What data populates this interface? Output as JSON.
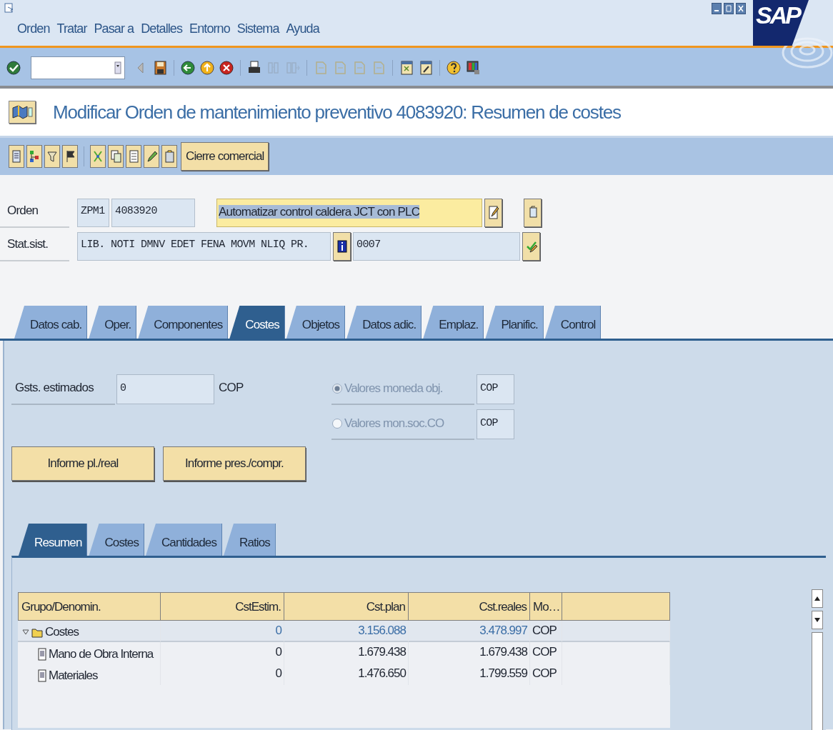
{
  "window": {
    "menu": [
      {
        "label": "Orden"
      },
      {
        "label": "Tratar"
      },
      {
        "label": "Pasar a"
      },
      {
        "label": "Detalles"
      },
      {
        "label": "Entorno"
      },
      {
        "label": "Sistema"
      },
      {
        "label": "Ayuda"
      }
    ],
    "logo": "SAP"
  },
  "title": "Modificar Orden de mantenimiento preventivo 4083920: Resumen de costes",
  "app_toolbar": {
    "button": "Cierre comercial"
  },
  "header": {
    "order": {
      "label": "Orden",
      "type": "ZPM1",
      "number": "4083920",
      "description": "Automatizar control caldera JCT con PLC",
      "selected": true
    },
    "status": {
      "label": "Stat.sist.",
      "system": "LIB. NOTI DMNV EDET FENA MOVM NLIQ PR.",
      "user": "0007"
    }
  },
  "tabs": [
    {
      "label": "Datos cab.",
      "selected": false
    },
    {
      "label": "Oper.",
      "selected": false
    },
    {
      "label": "Componentes",
      "selected": false
    },
    {
      "label": "Costes",
      "selected": true
    },
    {
      "label": "Objetos",
      "selected": false
    },
    {
      "label": "Datos adic.",
      "selected": false
    },
    {
      "label": "Emplaz.",
      "selected": false
    },
    {
      "label": "Planific.",
      "selected": false
    },
    {
      "label": "Control",
      "selected": false
    }
  ],
  "costs": {
    "estimated": {
      "label": "Gsts. estimados",
      "value": "0",
      "currency": "COP"
    },
    "currency_options": [
      {
        "label": "Valores moneda obj.",
        "selected": true,
        "disabled": true,
        "currency": "COP"
      },
      {
        "label": "Valores mon.soc.CO",
        "selected": false,
        "disabled": true,
        "currency": "COP"
      }
    ],
    "buttons": [
      "Informe pl./real",
      "Informe pres./compr."
    ]
  },
  "subtabs": [
    {
      "label": "Resumen",
      "selected": true
    },
    {
      "label": "Costes",
      "selected": false
    },
    {
      "label": "Cantidades",
      "selected": false
    },
    {
      "label": "Ratios",
      "selected": false
    }
  ],
  "table": {
    "columns": [
      "Grupo/Denomin.",
      "CstEstim.",
      "Cst.plan",
      "Cst.reales",
      "Mo…"
    ],
    "rows": [
      {
        "kind": "folder",
        "name": "Costes",
        "expanded": true,
        "estimated": "0",
        "plan": "3.156.088",
        "actual": "3.478.997",
        "currency": "COP",
        "children": [
          {
            "kind": "document",
            "name": "Mano de Obra Interna",
            "estimated": "0",
            "plan": "1.679.438",
            "actual": "1.679.438",
            "currency": "COP"
          },
          {
            "kind": "document",
            "name": "Materiales",
            "estimated": "0",
            "plan": "1.476.650",
            "actual": "1.799.559",
            "currency": "COP"
          }
        ]
      }
    ]
  }
}
